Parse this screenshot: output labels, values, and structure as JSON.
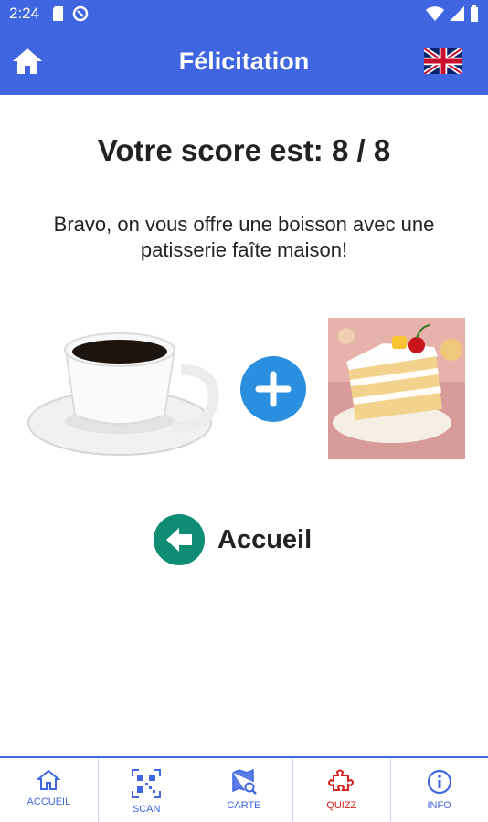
{
  "status_bar": {
    "time": "2:24"
  },
  "app_bar": {
    "title": "Félicitation"
  },
  "score_text": "Votre score est: 8 / 8",
  "message": "Bravo, on vous offre une boisson avec une patisserie faîte maison!",
  "home_link": {
    "label": "Accueil"
  },
  "bottom_nav": {
    "items": [
      {
        "label": "ACCUEIL",
        "icon": "home-icon"
      },
      {
        "label": "SCAN",
        "icon": "qr-code-icon"
      },
      {
        "label": "CARTE",
        "icon": "map-search-icon"
      },
      {
        "label": "QUIZZ",
        "icon": "puzzle-icon"
      },
      {
        "label": "INFO",
        "icon": "info-icon"
      }
    ],
    "active_index": 3
  },
  "colors": {
    "primary": "#3f66e0",
    "plus_button": "#2b8fe0",
    "back_button": "#0f8c74",
    "active_nav": "#d32020"
  }
}
